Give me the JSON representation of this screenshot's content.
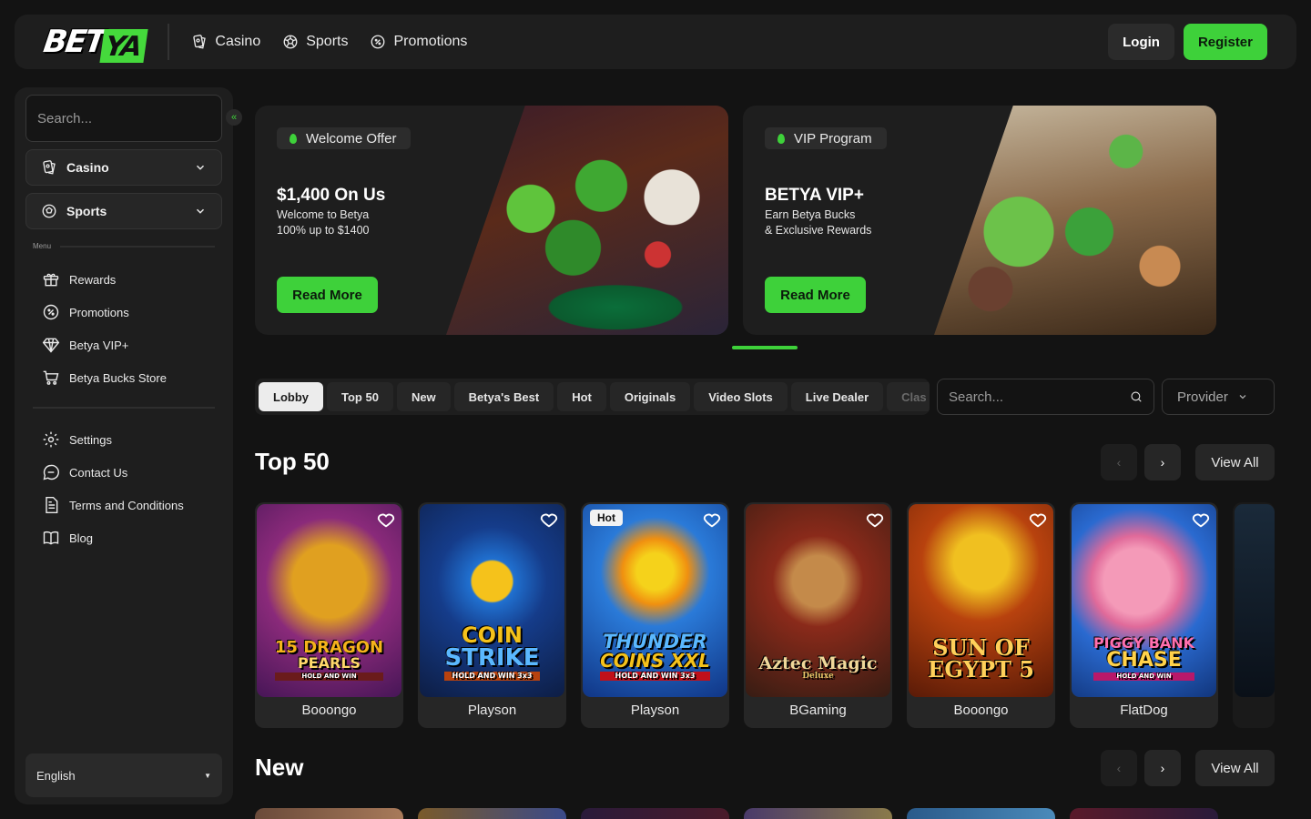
{
  "brand": {
    "logo_left": "BET",
    "logo_right": "YA"
  },
  "nav": [
    {
      "label": "Casino",
      "icon": "casino-card-icon"
    },
    {
      "label": "Sports",
      "icon": "soccer-ball-icon"
    },
    {
      "label": "Promotions",
      "icon": "promo-badge-icon"
    }
  ],
  "auth": {
    "login": "Login",
    "register": "Register"
  },
  "sidebar": {
    "search_placeholder": "Search...",
    "dropdowns": [
      {
        "label": "Casino",
        "icon": "casino-card-icon"
      },
      {
        "label": "Sports",
        "icon": "soccer-ball-icon"
      }
    ],
    "menu_label": "Menu",
    "menu": [
      {
        "label": "Rewards",
        "icon": "gift-icon"
      },
      {
        "label": "Promotions",
        "icon": "promo-badge-icon"
      },
      {
        "label": "Betya VIP+",
        "icon": "diamond-icon"
      },
      {
        "label": "Betya Bucks Store",
        "icon": "cart-icon"
      }
    ],
    "secondary": [
      {
        "label": "Settings",
        "icon": "gear-icon"
      },
      {
        "label": "Contact Us",
        "icon": "chat-icon"
      },
      {
        "label": "Terms and Conditions",
        "icon": "document-icon"
      },
      {
        "label": "Blog",
        "icon": "book-icon"
      }
    ],
    "language": "English"
  },
  "promos": [
    {
      "tag": "Welcome Offer",
      "title": "$1,400 On Us",
      "subtitle_line1": "Welcome to Betya",
      "subtitle_line2": "100% up to $1400",
      "cta": "Read More"
    },
    {
      "tag": "VIP Program",
      "title": "BETYA VIP+",
      "subtitle_line1": "Earn Betya Bucks",
      "subtitle_line2": "& Exclusive Rewards",
      "cta": "Read More"
    }
  ],
  "tabs": [
    "Lobby",
    "Top 50",
    "New",
    "Betya's Best",
    "Hot",
    "Originals",
    "Video Slots",
    "Live Dealer",
    "Clas"
  ],
  "active_tab": "Lobby",
  "filter": {
    "search_placeholder": "Search...",
    "provider": "Provider"
  },
  "sections": {
    "top50": {
      "title": "Top 50",
      "view_all": "View All"
    },
    "new": {
      "title": "New",
      "view_all": "View All"
    }
  },
  "games": [
    {
      "title_line1": "15 DRAGON",
      "title_line2": "PEARLS",
      "title_line3": "HOLD AND WIN",
      "provider": "Booongo",
      "badge": ""
    },
    {
      "title_line1": "COIN",
      "title_line2": "STRIKE",
      "title_line3": "HOLD AND WIN 3x3",
      "provider": "Playson",
      "badge": ""
    },
    {
      "title_line1": "THUNDER",
      "title_line2": "COINS XXL",
      "title_line3": "HOLD AND WIN 3x3",
      "provider": "Playson",
      "badge": "Hot"
    },
    {
      "title_line1": "Aztec Magic",
      "title_line2": "Deluxe",
      "title_line3": "",
      "provider": "BGaming",
      "badge": ""
    },
    {
      "title_line1": "SUN OF",
      "title_line2": "EGYPT 5",
      "title_line3": "",
      "provider": "Booongo",
      "badge": ""
    },
    {
      "title_line1": "PIGGY BANK",
      "title_line2": "CHASE",
      "title_line3": "HOLD AND WIN",
      "provider": "FlatDog",
      "badge": ""
    }
  ],
  "colors": {
    "accent": "#3ed13a",
    "panel": "#1e1e1e",
    "background": "#131313"
  }
}
